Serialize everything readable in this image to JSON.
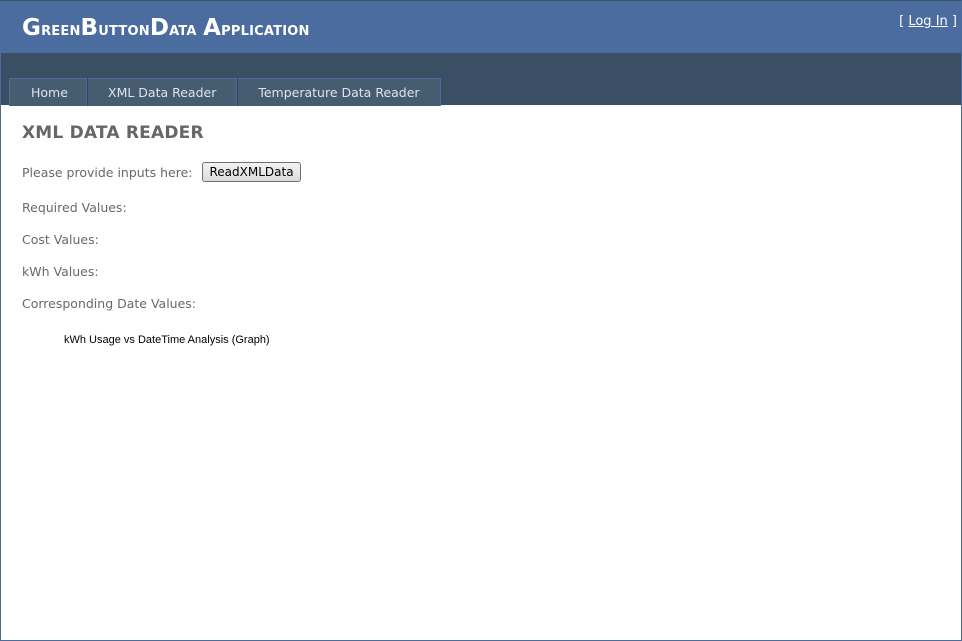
{
  "header": {
    "title_parts": [
      {
        "cap": "G",
        "rest": "reen"
      },
      {
        "cap": "B",
        "rest": "utton"
      },
      {
        "cap": "D",
        "rest": "ata "
      },
      {
        "cap": "A",
        "rest": "pplication"
      }
    ],
    "login_open": "[ ",
    "login_link": "Log In",
    "login_close": " ]"
  },
  "nav": {
    "items": [
      {
        "label": "Home"
      },
      {
        "label": "XML Data Reader"
      },
      {
        "label": "Temperature Data Reader"
      }
    ]
  },
  "main": {
    "heading": "XML DATA READER",
    "prompt_label": "Please provide inputs here:",
    "button_label": "ReadXMLData",
    "fields": {
      "required": "Required Values:",
      "cost": "Cost Values:",
      "kwh": "kWh Values:",
      "dates": "Corresponding Date Values:"
    },
    "graph_title": "kWh Usage vs DateTime Analysis (Graph)"
  },
  "colors": {
    "header_bg": "#4b6c9e",
    "menubar_bg": "#3a4f63",
    "menu_item_bg": "#465c71",
    "text_gray": "#696969"
  }
}
